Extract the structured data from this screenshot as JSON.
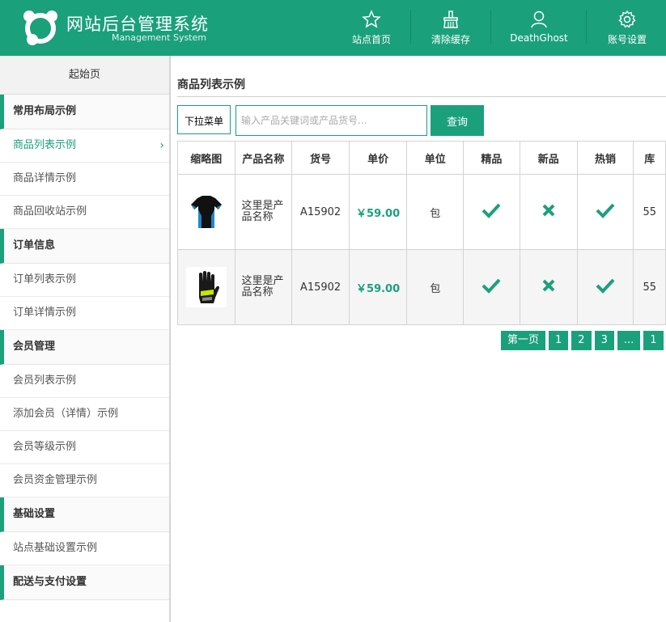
{
  "header": {
    "title": "网站后台管理系统",
    "subtitle": "Management System",
    "nav": [
      {
        "label": "站点首页",
        "icon": "star-icon"
      },
      {
        "label": "清除缓存",
        "icon": "broom-icon"
      },
      {
        "label": "DeathGhost",
        "icon": "user-icon"
      },
      {
        "label": "账号设置",
        "icon": "gear-icon"
      }
    ]
  },
  "sidebar": {
    "home": "起始页",
    "groups": [
      {
        "title": "常用布局示例",
        "items": [
          "商品列表示例",
          "商品详情示例",
          "商品回收站示例"
        ]
      },
      {
        "title": "订单信息",
        "items": [
          "订单列表示例",
          "订单详情示例"
        ]
      },
      {
        "title": "会员管理",
        "items": [
          "会员列表示例",
          "添加会员（详情）示例",
          "会员等级示例",
          "会员资金管理示例"
        ]
      },
      {
        "title": "基础设置",
        "items": [
          "站点基础设置示例"
        ]
      },
      {
        "title": "配送与支付设置",
        "items": []
      }
    ],
    "active_item": "商品列表示例"
  },
  "main": {
    "title": "商品列表示例",
    "dropdown_label": "下拉菜单",
    "search_placeholder": "输入产品关键词或产品货号...",
    "search_button": "查询",
    "table": {
      "headers": [
        "缩略图",
        "产品名称",
        "货号",
        "单价",
        "单位",
        "精品",
        "新品",
        "热销",
        "库"
      ],
      "rows": [
        {
          "thumb": "shirt-image",
          "name": "这里是产品名称",
          "sku": "A15902",
          "price": "￥59.00",
          "unit": "包",
          "featured": "check",
          "new": "cross",
          "hot": "check",
          "stock": "55"
        },
        {
          "thumb": "glove-image",
          "name": "这里是产品名称",
          "sku": "A15902",
          "price": "￥59.00",
          "unit": "包",
          "featured": "check",
          "new": "cross",
          "hot": "check",
          "stock": "55"
        }
      ]
    },
    "pager": [
      "第一页",
      "1",
      "2",
      "3",
      "...",
      "1"
    ]
  },
  "colors": {
    "accent": "#1ba07c"
  }
}
